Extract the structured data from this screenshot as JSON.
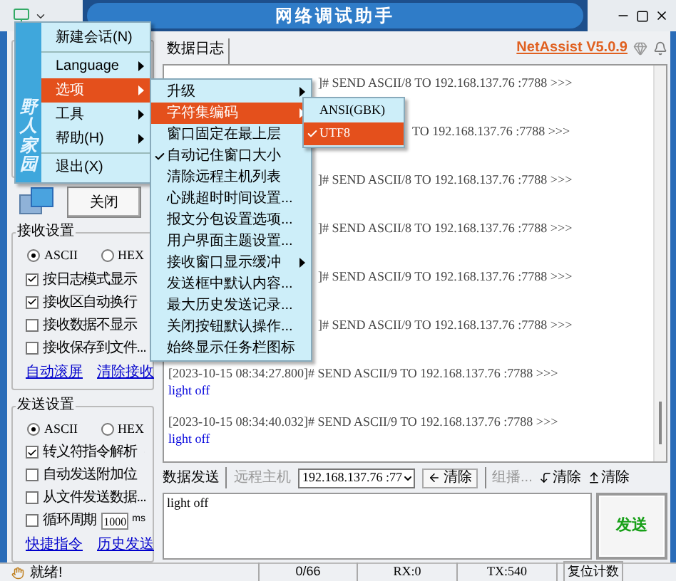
{
  "window": {
    "title": "网络调试助手"
  },
  "menu": {
    "brand": "野人家园",
    "items": [
      {
        "kind": "item",
        "label": "新建会话(N)",
        "submenu": false,
        "selected": false
      },
      {
        "kind": "separator"
      },
      {
        "kind": "item",
        "label": "Language",
        "submenu": true,
        "selected": false
      },
      {
        "kind": "item",
        "label": "选项",
        "submenu": true,
        "selected": true
      },
      {
        "kind": "item",
        "label": "工具",
        "submenu": true,
        "selected": false
      },
      {
        "kind": "item",
        "label": "帮助(H)",
        "submenu": true,
        "selected": false
      },
      {
        "kind": "separator"
      },
      {
        "kind": "item",
        "label": "退出(X)",
        "submenu": false,
        "selected": false
      }
    ]
  },
  "options_menu": {
    "items": [
      {
        "label": "升级",
        "submenu": true,
        "checked": false,
        "selected": false
      },
      {
        "label": "字符集编码",
        "submenu": true,
        "checked": false,
        "selected": true
      },
      {
        "label": "窗口固定在最上层",
        "submenu": false,
        "checked": false,
        "selected": false
      },
      {
        "label": "自动记住窗口大小",
        "submenu": false,
        "checked": true,
        "selected": false
      },
      {
        "label": "清除远程主机列表",
        "submenu": false,
        "checked": false,
        "selected": false
      },
      {
        "label": "心跳超时时间设置...",
        "submenu": false,
        "checked": false,
        "selected": false
      },
      {
        "label": "报文分包设置选项...",
        "submenu": false,
        "checked": false,
        "selected": false
      },
      {
        "label": "用户界面主题设置...",
        "submenu": false,
        "checked": false,
        "selected": false
      },
      {
        "label": "接收窗口显示缓冲",
        "submenu": true,
        "checked": false,
        "selected": false
      },
      {
        "label": "发送框中默认内容...",
        "submenu": false,
        "checked": false,
        "selected": false
      },
      {
        "label": "最大历史发送记录...",
        "submenu": false,
        "checked": false,
        "selected": false
      },
      {
        "label": "关闭按钮默认操作...",
        "submenu": false,
        "checked": false,
        "selected": false
      },
      {
        "label": "始终显示任务栏图标",
        "submenu": false,
        "checked": false,
        "selected": false
      }
    ]
  },
  "encoding_menu": {
    "items": [
      {
        "label": "ANSI(GBK)",
        "checked": false,
        "selected": false
      },
      {
        "label": "UTF8",
        "checked": true,
        "selected": true
      }
    ]
  },
  "close_button": "关闭",
  "receive_settings": {
    "title": "接收设置",
    "modes": [
      {
        "label": "ASCII",
        "selected": true
      },
      {
        "label": "HEX",
        "selected": false
      }
    ],
    "options": [
      {
        "kind": "plain",
        "label": "按日志模式显示",
        "checked": true
      },
      {
        "kind": "plain",
        "label": "接收区自动换行",
        "checked": true
      },
      {
        "kind": "plain",
        "label": "接收数据不显示",
        "checked": false
      },
      {
        "kind": "plain",
        "label": "接收保存到文件...",
        "checked": false
      }
    ],
    "links": [
      "自动滚屏",
      "清除接收"
    ]
  },
  "send_settings": {
    "title": "发送设置",
    "modes": [
      {
        "label": "ASCII",
        "selected": true
      },
      {
        "label": "HEX",
        "selected": false
      }
    ],
    "options": [
      {
        "kind": "info",
        "label": "转义符指令解析",
        "checked": true
      },
      {
        "kind": "plain",
        "label": "自动发送附加位",
        "checked": false
      },
      {
        "kind": "plain",
        "label": "从文件发送数据...",
        "checked": false
      },
      {
        "kind": "period",
        "label": "循环周期",
        "checked": false,
        "value": "1000",
        "unit": "ms"
      }
    ],
    "links": [
      "快捷指令",
      "历史发送"
    ]
  },
  "log": {
    "tab": "数据日志",
    "version": "NetAssist V5.0.9",
    "entries": [
      {
        "kind": "tail",
        "text": "]# SEND ASCII/8 TO 192.168.137.76 :7788 >>>"
      },
      {
        "kind": "tail2",
        "text": "TO 192.168.137.76 :7788 >>>"
      },
      {
        "kind": "tail",
        "text": "]# SEND ASCII/8 TO 192.168.137.76 :7788 >>>"
      },
      {
        "kind": "tail",
        "text": "]# SEND ASCII/8 TO 192.168.137.76 :7788 >>>"
      },
      {
        "kind": "tail",
        "text": "]# SEND ASCII/9 TO 192.168.137.76 :7788 >>>"
      },
      {
        "kind": "tail",
        "text": "]# SEND ASCII/9 TO 192.168.137.76 :7788 >>>"
      },
      {
        "kind": "full",
        "text": "[2023-10-15 08:34:27.800]# SEND ASCII/9 TO 192.168.137.76 :7788 >>>",
        "body": "light off"
      },
      {
        "kind": "full",
        "text": "[2023-10-15 08:34:40.032]# SEND ASCII/9 TO 192.168.137.76 :7788 >>>",
        "body": "light off"
      }
    ]
  },
  "send": {
    "tab": "数据发送",
    "remote_label": "远程主机",
    "remote_host": "192.168.137.76 :77",
    "clear_button": "清除",
    "multicast": "组播...",
    "clear_down": "清除",
    "clear_up": "清除",
    "text": "light off",
    "send_button": "发送"
  },
  "status_bar": {
    "message": "就绪!",
    "counter": "0/66",
    "rx": "RX:0",
    "tx": "TX:540",
    "reset_button": "复位计数"
  }
}
